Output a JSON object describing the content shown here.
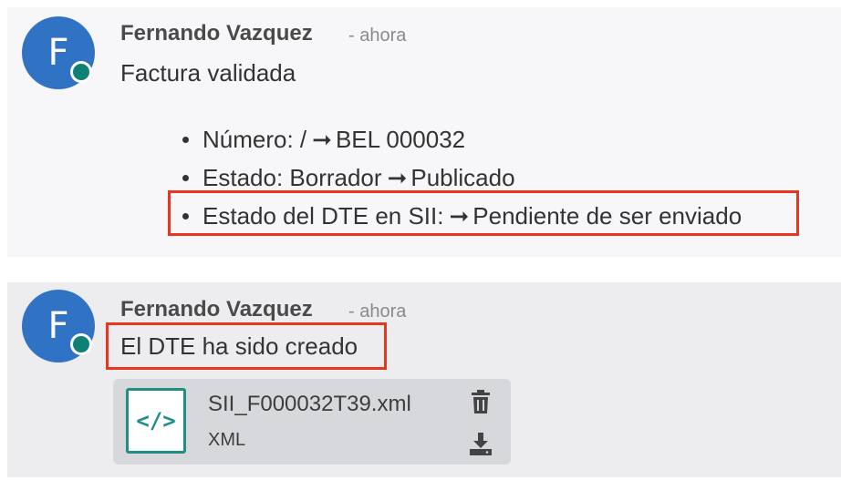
{
  "messages": [
    {
      "avatar_initial": "F",
      "author": "Fernando Vazquez",
      "time": "- ahora",
      "body": "Factura validada",
      "changes": [
        {
          "field": "Número: /",
          "value": "BEL 000032"
        },
        {
          "field": "Estado: Borrador",
          "value": "Publicado"
        },
        {
          "field": "Estado del DTE en SII:",
          "value": "Pendiente de ser enviado"
        }
      ]
    },
    {
      "avatar_initial": "F",
      "author": "Fernando Vazquez",
      "time": "- ahora",
      "body": "El DTE ha sido creado",
      "attachment": {
        "icon_glyph": "</>",
        "file_name": "SII_F000032T39.xml",
        "file_type": "XML"
      }
    }
  ],
  "arrow_glyph": "➞",
  "colors": {
    "avatar": "#3072c4",
    "status_dot": "#0f8075",
    "highlight": "#e8361f",
    "file_icon": "#1f8f86"
  },
  "icons": [
    "online-status-icon",
    "arrow-right-icon",
    "xml-code-icon",
    "trash-icon",
    "download-icon"
  ]
}
